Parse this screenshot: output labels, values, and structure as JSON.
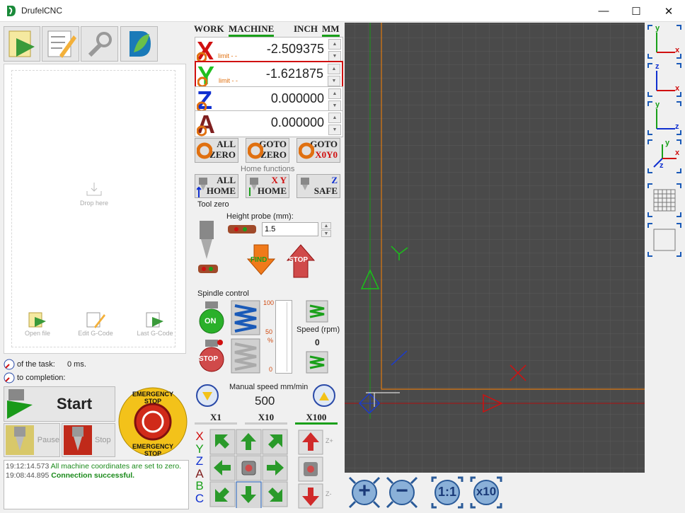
{
  "window": {
    "title": "DrufelCNC",
    "controls": {
      "minimize": "—",
      "maximize": "☐",
      "close": "✕"
    }
  },
  "coords": {
    "mode_work": "WORK",
    "mode_machine": "MACHINE",
    "unit_inch": "INCH",
    "unit_mm": "MM",
    "axes": [
      {
        "letter": "X",
        "value": "-2.509375",
        "limit": "limit - -",
        "color": "#d01010"
      },
      {
        "letter": "Y",
        "value": "-1.621875",
        "limit": "limit - -",
        "color": "#20c020"
      },
      {
        "letter": "Z",
        "value": "0.000000",
        "limit": "",
        "color": "#1030d0"
      },
      {
        "letter": "A",
        "value": "0.000000",
        "limit": "",
        "color": "#802020"
      }
    ]
  },
  "zero_buttons": {
    "all_zero": [
      "ALL",
      "ZERO"
    ],
    "goto_zero": [
      "GOTO",
      "ZERO"
    ],
    "goto_x0y0": [
      "GOTO",
      "X0Y0"
    ]
  },
  "home": {
    "label": "Home functions",
    "all_home": [
      "ALL",
      "HOME"
    ],
    "xy_home": [
      "X Y",
      "HOME"
    ],
    "z_safe": [
      "Z",
      "SAFE"
    ]
  },
  "tool_zero": {
    "label": "Tool zero",
    "height_probe_label": "Height probe (mm):",
    "height_probe_value": "1.5",
    "find_label": "FIND",
    "stop_label": "STOP"
  },
  "spindle": {
    "label": "Spindle control",
    "on_label": "ON",
    "stop_label": "STOP",
    "scale_100": "100",
    "scale_50": "50",
    "scale_pct": "%",
    "scale_0": "0",
    "speed_label": "Speed (rpm)",
    "speed_value": "0",
    "slider_level_pct": 0
  },
  "manual": {
    "label": "Manual speed mm/min",
    "value": "500",
    "mult_x1": "X1",
    "mult_x10": "X10",
    "mult_x100": "X100",
    "axis_letters": [
      "X",
      "Y",
      "Z",
      "A",
      "B",
      "C"
    ],
    "z_plus": "Z+",
    "z_minus": "Z-"
  },
  "file_panel": {
    "drop_here": "Drop here",
    "open_file": "Open file",
    "edit_gcode": "Edit G-Code",
    "last_gcode": "Last G-Code"
  },
  "status": {
    "task_label": "of the task:",
    "task_value": "0 ms.",
    "completion_label": "to completion:"
  },
  "controls": {
    "start": "Start",
    "pause": "Pause",
    "stop": "Stop",
    "emergency_top": "EMERGENCY STOP",
    "emergency_bottom": "EMERGENCY STOP"
  },
  "log": [
    {
      "time": "19:12:14.573",
      "msg": "All machine coordinates are set to zero."
    },
    {
      "time": "19:08:44.895",
      "msg": "Connection successful."
    }
  ],
  "zoom": {
    "in": "+",
    "out": "−",
    "one_to_one": "1:1",
    "x10": "x10"
  },
  "views": {
    "xy": [
      "y",
      "x"
    ],
    "xz": [
      "z",
      "x"
    ],
    "yz": [
      "y",
      "z"
    ],
    "iso": [
      "y",
      "x",
      "z"
    ]
  },
  "colors": {
    "accent_green": "#1aa01a",
    "accent_orange": "#e07010",
    "viewport_bg": "#4a4a4a",
    "highlight_red": "#d01010"
  }
}
